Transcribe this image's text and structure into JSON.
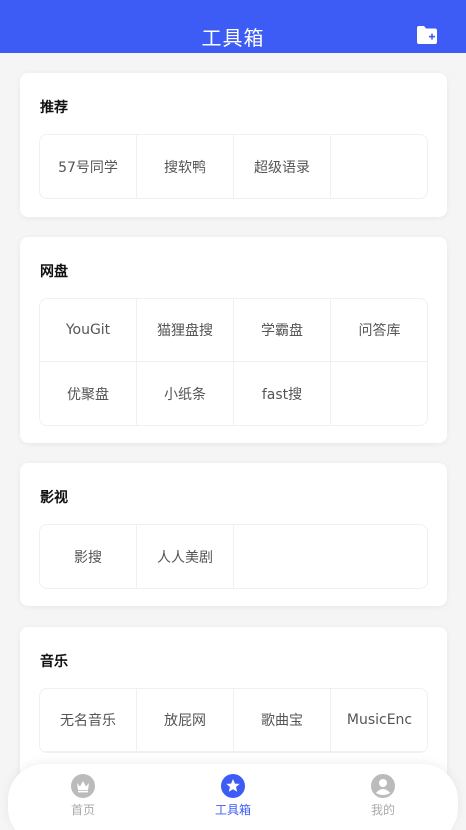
{
  "header": {
    "title": "工具箱"
  },
  "colors": {
    "primary": "#3d5cf5",
    "inactive": "#bbbbbb",
    "text": "#555555"
  },
  "sections": [
    {
      "title": "推荐",
      "items": [
        "57号同学",
        "搜软鸭",
        "超级语录"
      ]
    },
    {
      "title": "网盘",
      "items": [
        "YouGit",
        "猫狸盘搜",
        "学霸盘",
        "问答库",
        "优聚盘",
        "小纸条",
        "fast搜"
      ]
    },
    {
      "title": "影视",
      "items": [
        "影搜",
        "人人美剧"
      ]
    },
    {
      "title": "音乐",
      "items": [
        "无名音乐",
        "放屁网",
        "歌曲宝",
        "MusicEnc"
      ]
    }
  ],
  "tabbar": {
    "items": [
      {
        "label": "首页",
        "icon": "crown-icon",
        "active": false
      },
      {
        "label": "工具箱",
        "icon": "star-icon",
        "active": true
      },
      {
        "label": "我的",
        "icon": "user-icon",
        "active": false
      }
    ]
  }
}
